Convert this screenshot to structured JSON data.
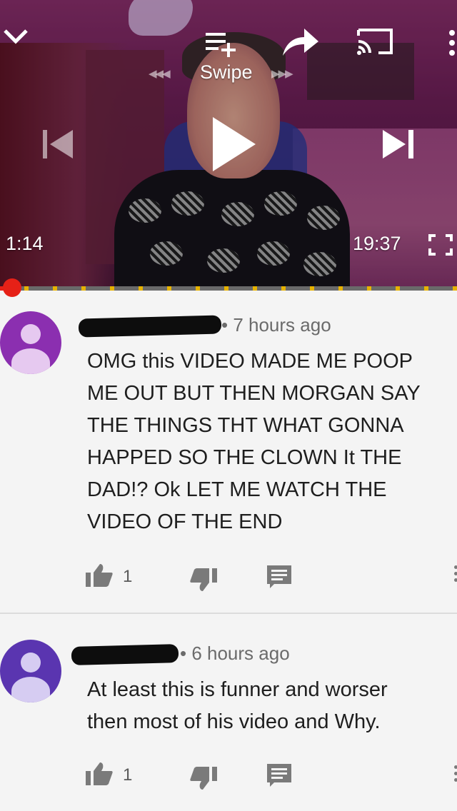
{
  "player": {
    "swipe_label": "Swipe",
    "swipe_left_glyph": "◀◀◀",
    "swipe_right_glyph": "▶▶▶",
    "current_time": "1:14",
    "duration": "19:37",
    "progress_fraction": 0.0,
    "icons": [
      "chevron-down-icon",
      "add-to-playlist-icon",
      "share-icon",
      "cast-icon",
      "more-vert-icon",
      "previous-icon",
      "play-icon",
      "next-icon",
      "fullscreen-icon"
    ]
  },
  "comments": [
    {
      "avatar_color": "#8b2fb0",
      "meta": "• 7 hours ago",
      "lines": [
        "OMG this VIDEO  MADE ME POOP",
        "ME OUT  BUT THEN MORGAN  SAY",
        "THE THINGS THT WHAT GONNA",
        "HAPPED SO THE CLOWN It THE",
        "DAD!? Ok LET ME WATCH THE",
        "VIDEO  OF THE END"
      ],
      "likes": "1"
    },
    {
      "avatar_color": "#5a35b0",
      "meta": "• 6 hours ago",
      "lines": [
        "At least this is funner and worser",
        "then most of his video and Why."
      ],
      "likes": "1"
    }
  ],
  "colors": {
    "progress": "#e62117",
    "ad_marker": "#e7b300",
    "background": "#f4f4f4"
  }
}
